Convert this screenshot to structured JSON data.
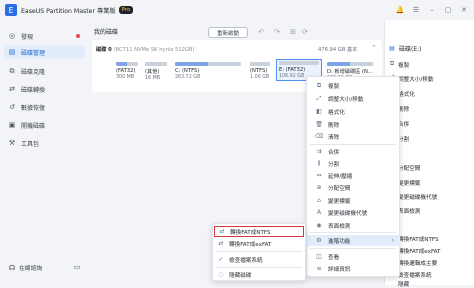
{
  "window": {
    "title": "EaseUS Partition Master",
    "edition": "專業版",
    "badge": "Pro",
    "logo": "E",
    "icons": [
      "bell-icon",
      "menu-icon",
      "minimize-icon",
      "maximize-icon",
      "close-icon"
    ]
  },
  "sidebar": {
    "items": [
      {
        "label": "發現",
        "icon": "compass-icon"
      },
      {
        "label": "磁碟管理",
        "icon": "disk-icon",
        "active": true
      },
      {
        "label": "磁碟克隆",
        "icon": "clone-icon"
      },
      {
        "label": "磁碟轉換",
        "icon": "convert-icon"
      },
      {
        "label": "數據恢復",
        "icon": "recovery-icon"
      },
      {
        "label": "開機磁碟",
        "icon": "boot-icon"
      },
      {
        "label": "工具包",
        "icon": "toolkit-icon"
      }
    ],
    "online_help": "在線諮詢",
    "online_help_icon": "headset-icon",
    "chat_icon": "chat-icon"
  },
  "main": {
    "title": "我的磁碟",
    "reboot_button": "重新啟動",
    "disk": {
      "name": "磁碟 0",
      "model": "(BC711 NVMe SK hynix 512GB)",
      "capacity": "476.94 GB 基本",
      "partitions": [
        {
          "name": "(FAT32)",
          "size": "300 MB"
        },
        {
          "name": "(其他)",
          "size": "16 MB"
        },
        {
          "name": "C: (NTFS)",
          "size": "263.72 GB"
        },
        {
          "name": "(NTFS)",
          "size": "1.00 GB"
        },
        {
          "name": "E: (FAT32)",
          "size": "106.92 GB",
          "selected": true
        },
        {
          "name": "D: 新增磁碟區 (N...",
          "size": "105.00 GB"
        }
      ]
    }
  },
  "right_panel": {
    "header": "磁碟(E:)",
    "header_icon": "disk-icon",
    "items": [
      "複製",
      "調整大小/移動",
      "格式化",
      "刪除",
      "合併",
      "分割",
      "分配空間",
      "變更標籤",
      "變更磁碟機代號",
      "表面檢測",
      "轉換FAT成NTFS",
      "轉換FAT成exFAT",
      "轉換邏輯成主要",
      "檢查檔案系統",
      "隱藏"
    ],
    "item_icons": [
      "copy-icon",
      "resize-icon",
      "format-icon",
      "delete-icon",
      "merge-icon",
      "split-icon",
      "allocate-icon",
      "tag-icon",
      "letter-icon",
      "surface-test-icon",
      "convert-icon",
      "convert-icon",
      "convert-icon",
      "check-icon",
      "hide-icon"
    ]
  },
  "context_menu": {
    "items": [
      {
        "label": "複製",
        "icon": "copy-icon"
      },
      {
        "label": "調整大小/移動",
        "icon": "resize-icon"
      },
      {
        "label": "格式化",
        "icon": "format-icon"
      },
      {
        "label": "刪除",
        "icon": "delete-icon"
      },
      {
        "label": "清除",
        "icon": "wipe-icon"
      },
      {
        "label": "合併",
        "icon": "merge-icon"
      },
      {
        "label": "分割",
        "icon": "split-icon"
      },
      {
        "label": "延伸/壓縮",
        "icon": "extend-icon"
      },
      {
        "label": "分配空間",
        "icon": "allocate-icon"
      },
      {
        "label": "變更標籤",
        "icon": "tag-icon"
      },
      {
        "label": "變更磁碟機代號",
        "icon": "letter-icon"
      },
      {
        "label": "表面檢測",
        "icon": "surface-test-icon"
      },
      {
        "label": "進階功能",
        "icon": "advanced-icon",
        "active": true
      },
      {
        "label": "查看",
        "icon": "view-icon"
      },
      {
        "label": "詳細資訊",
        "icon": "info-icon"
      }
    ]
  },
  "submenu": {
    "items": [
      {
        "label": "轉換FAT成NTFS",
        "icon": "convert-icon",
        "highlight": true
      },
      {
        "label": "轉換FAT成exFAT",
        "icon": "convert-icon"
      },
      {
        "label": "檢查檔案系統",
        "icon": "check-icon"
      },
      {
        "label": "隱藏磁碟",
        "icon": "hide-icon"
      }
    ]
  }
}
